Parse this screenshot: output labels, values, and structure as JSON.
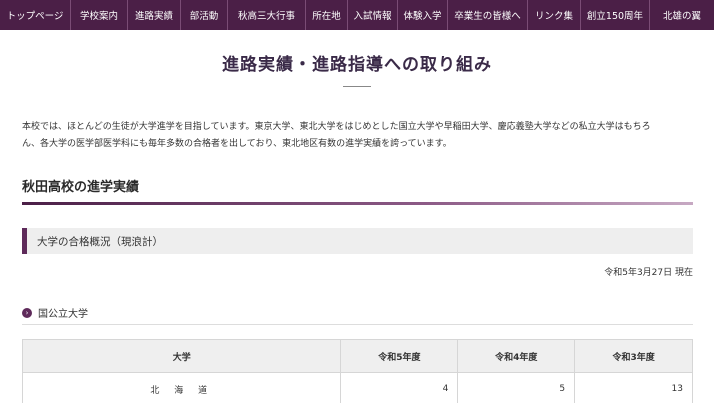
{
  "nav": {
    "items": [
      "トップページ",
      "学校案内",
      "進路実績",
      "部活動",
      "秋高三大行事",
      "所在地",
      "入試情報",
      "体験入学",
      "卒業生の皆様へ",
      "リンク集",
      "創立150周年",
      "北雄の翼"
    ]
  },
  "page_title": "進路実績・進路指導への取り組み",
  "intro": {
    "line1": "本校では、ほとんどの生徒が大学進学を目指しています。東京大学、東北大学をはじめとした国立大学や早稲田大学、慶応義塾大学などの私立大学はもちろ",
    "line2": "ん、各大学の医学部医学科にも毎年多数の合格者を出しており、東北地区有数の進学実績を誇っています。"
  },
  "section_heading": "秋田高校の進学実績",
  "sub_heading": "大学の合格概況（現浪計）",
  "as_of": "令和5年3月27日 現在",
  "category": {
    "icon": "chevron-right-circle-icon",
    "label": "国公立大学"
  },
  "table": {
    "headers": [
      "大学",
      "令和5年度",
      "令和4年度",
      "令和3年度"
    ],
    "rows": [
      {
        "university": "北 海 道",
        "r5": "4",
        "r4": "5",
        "r3": "13"
      }
    ]
  },
  "colors": {
    "nav_bg": "#4b1f47",
    "accent": "#5e2a5a",
    "header_cell_bg": "#efefef"
  }
}
